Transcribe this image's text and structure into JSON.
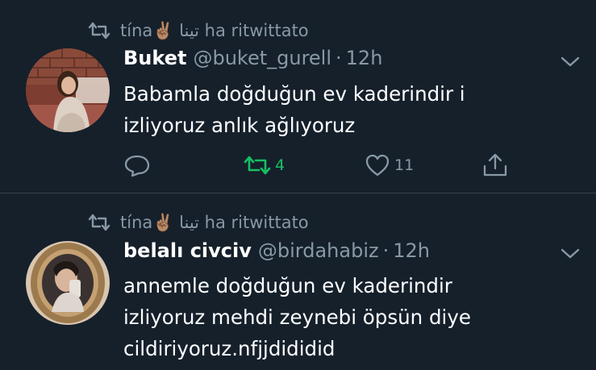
{
  "tweets": [
    {
      "retweet_label": "tína✌🏽 تينا ha ritwittato",
      "name": "Buket",
      "handle": "@buket_gurell",
      "separator": "·",
      "time": "12h",
      "body_lines": [
        "Babamla doğduğun ev kaderindir i",
        "izliyoruz anlık ağlıyoruz"
      ],
      "actions": {
        "reply_count": "",
        "retweet_count": "4",
        "like_count": "11"
      },
      "retweeted": true
    },
    {
      "retweet_label": "tína✌🏽 تينا ha ritwittato",
      "name": "belalı civciv",
      "handle": "@birdahabiz",
      "separator": "·",
      "time": "12h",
      "body_lines": [
        "annemle doğduğun ev kaderindir",
        "izliyoruz mehdi zeynebi öpsün diye",
        "cildiriyoruz.nfjjdididid"
      ]
    }
  ],
  "colors": {
    "background": "#15202b",
    "secondary_text": "#8899a6",
    "retweet_green": "#17bf63",
    "divider": "#38444d"
  },
  "icons": [
    "retweet-icon",
    "chevron-down-icon",
    "reply-icon",
    "like-icon",
    "share-icon"
  ]
}
